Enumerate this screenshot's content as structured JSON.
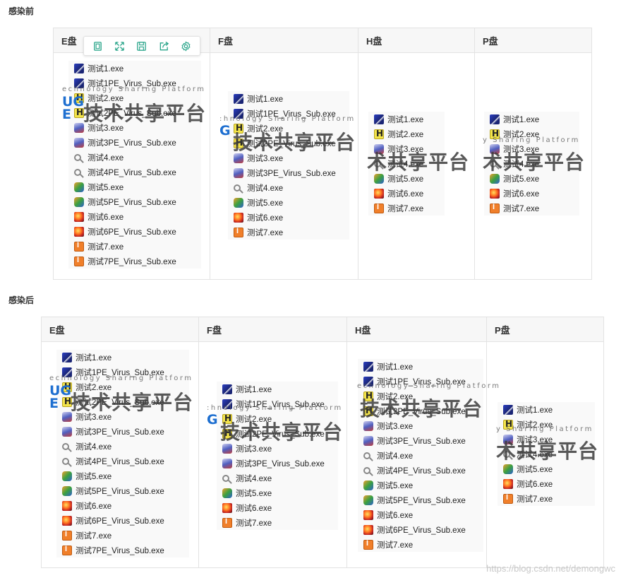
{
  "sections": {
    "before_title": "感染前",
    "after_title": "感染后"
  },
  "drive_headers": [
    "E盘",
    "F盘",
    "H盘",
    "P盘"
  ],
  "files": {
    "e": [
      {
        "icon": "blue",
        "name": "测试1.exe"
      },
      {
        "icon": "blue",
        "name": "测试1PE_Virus_Sub.exe"
      },
      {
        "icon": "yellow",
        "name": "测试2.exe"
      },
      {
        "icon": "yellow",
        "name": "测试2PE_Virus_Sub.exe"
      },
      {
        "icon": "install",
        "name": "测试3.exe"
      },
      {
        "icon": "install",
        "name": "测试3PE_Virus_Sub.exe"
      },
      {
        "icon": "search",
        "name": "测试4.exe"
      },
      {
        "icon": "search",
        "name": "测试4PE_Virus_Sub.exe"
      },
      {
        "icon": "puzzle",
        "name": "测试5.exe"
      },
      {
        "icon": "puzzle",
        "name": "测试5PE_Virus_Sub.exe"
      },
      {
        "icon": "gem",
        "name": "测试6.exe"
      },
      {
        "icon": "gem",
        "name": "测试6PE_Virus_Sub.exe"
      },
      {
        "icon": "orange",
        "name": "测试7.exe"
      },
      {
        "icon": "orange",
        "name": "测试7PE_Virus_Sub.exe"
      }
    ],
    "f": [
      {
        "icon": "blue",
        "name": "测试1.exe"
      },
      {
        "icon": "blue",
        "name": "测试1PE_Virus_Sub.exe"
      },
      {
        "icon": "yellow",
        "name": "测试2.exe"
      },
      {
        "icon": "yellow",
        "name": "测试2PE_Virus_Sub.exe"
      },
      {
        "icon": "install",
        "name": "测试3.exe"
      },
      {
        "icon": "install",
        "name": "测试3PE_Virus_Sub.exe"
      },
      {
        "icon": "search",
        "name": "测试4.exe"
      },
      {
        "icon": "puzzle",
        "name": "测试5.exe"
      },
      {
        "icon": "gem",
        "name": "测试6.exe"
      },
      {
        "icon": "orange",
        "name": "测试7.exe"
      }
    ],
    "h_before": [
      {
        "icon": "blue",
        "name": "测试1.exe"
      },
      {
        "icon": "yellow",
        "name": "测试2.exe"
      },
      {
        "icon": "install",
        "name": "测试3.exe"
      },
      {
        "icon": "search",
        "name": "测试4.exe"
      },
      {
        "icon": "puzzle",
        "name": "测试5.exe"
      },
      {
        "icon": "gem",
        "name": "测试6.exe"
      },
      {
        "icon": "orange",
        "name": "测试7.exe"
      }
    ],
    "p": [
      {
        "icon": "blue",
        "name": "测试1.exe"
      },
      {
        "icon": "yellow",
        "name": "测试2.exe"
      },
      {
        "icon": "install",
        "name": "测试3.exe"
      },
      {
        "icon": "search",
        "name": "测试4.exe"
      },
      {
        "icon": "puzzle",
        "name": "测试5.exe"
      },
      {
        "icon": "gem",
        "name": "测试6.exe"
      },
      {
        "icon": "orange",
        "name": "测试7.exe"
      }
    ],
    "h_after": [
      {
        "icon": "blue",
        "name": "测试1.exe"
      },
      {
        "icon": "blue",
        "name": "测试1PE_Virus_Sub.exe"
      },
      {
        "icon": "yellow",
        "name": "测试2.exe"
      },
      {
        "icon": "yellow",
        "name": "测试2PE_Virus_Sub.exe"
      },
      {
        "icon": "install",
        "name": "测试3.exe"
      },
      {
        "icon": "install",
        "name": "测试3PE_Virus_Sub.exe"
      },
      {
        "icon": "search",
        "name": "测试4.exe"
      },
      {
        "icon": "search",
        "name": "测试4PE_Virus_Sub.exe"
      },
      {
        "icon": "puzzle",
        "name": "测试5.exe"
      },
      {
        "icon": "puzzle",
        "name": "测试5PE_Virus_Sub.exe"
      },
      {
        "icon": "gem",
        "name": "测试6.exe"
      },
      {
        "icon": "gem",
        "name": "测试6PE_Virus_Sub.exe"
      },
      {
        "icon": "orange",
        "name": "测试7.exe"
      }
    ]
  },
  "toolbar_icons": [
    "copy-icon",
    "expand-icon",
    "save-icon",
    "share-icon",
    "settings-icon"
  ],
  "watermark": {
    "big_full": "技术共享平台",
    "big_short": "术共享平台",
    "small_e": "echnology Sharing Platform",
    "small_f": ":hnology Sharing Platform",
    "small_h": "echnology Sharing Platform",
    "small_p": "y Sharing Platform",
    "logo_ug": "UG",
    "logo_e": "E",
    "logo_g": "G"
  },
  "credit": "https://blog.csdn.net/demongwc",
  "colors": {
    "toolbar_icon": "#2aa58a",
    "header_bg": "#f7f7f7",
    "border": "#e3e3e3"
  }
}
